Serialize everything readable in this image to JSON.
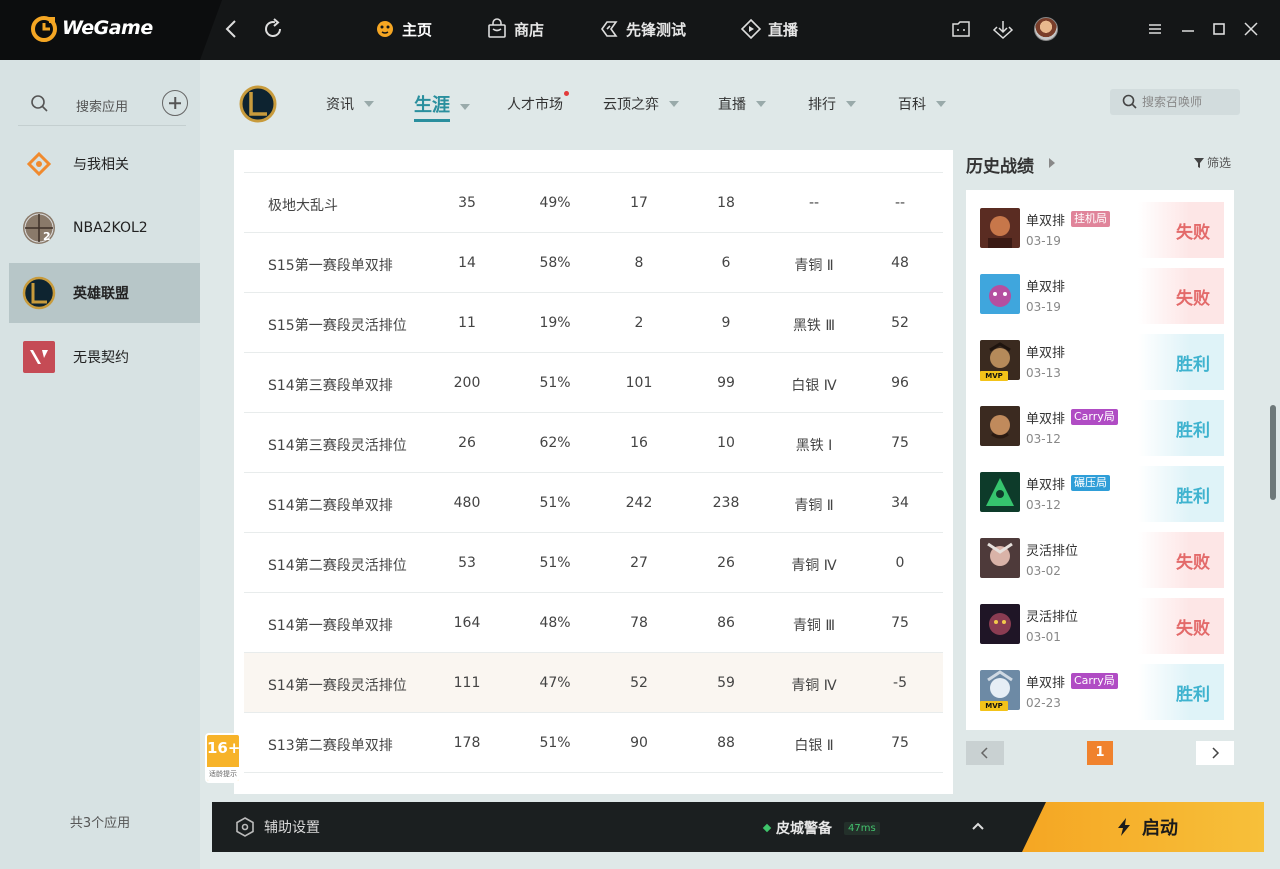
{
  "app": {
    "name": "WeGame"
  },
  "main_nav": [
    {
      "label": "主页",
      "icon": "home-cat-icon",
      "active": true
    },
    {
      "label": "商店",
      "icon": "store-bag-icon",
      "active": false
    },
    {
      "label": "先锋测试",
      "icon": "pioneer-test-icon",
      "active": false
    },
    {
      "label": "直播",
      "icon": "live-stream-icon",
      "active": false
    }
  ],
  "sidebar": {
    "search_label": "搜索应用",
    "items": [
      {
        "label": "与我相关",
        "icon": "related-to-me-icon",
        "active": false
      },
      {
        "label": "NBA2KOL2",
        "icon": "nba2kol2-icon",
        "active": false
      },
      {
        "label": "英雄联盟",
        "icon": "league-of-legends-icon",
        "active": true
      },
      {
        "label": "无畏契约",
        "icon": "valorant-icon",
        "active": false
      }
    ],
    "footer": "共3个应用"
  },
  "sub_nav": {
    "tabs": [
      {
        "label": "资讯",
        "has_caret": true,
        "active": false,
        "dot": false
      },
      {
        "label": "生涯",
        "has_caret": true,
        "active": true,
        "dot": false
      },
      {
        "label": "人才市场",
        "has_caret": false,
        "active": false,
        "dot": true
      },
      {
        "label": "云顶之弈",
        "has_caret": true,
        "active": false,
        "dot": false
      },
      {
        "label": "直播",
        "has_caret": true,
        "active": false,
        "dot": false
      },
      {
        "label": "排行",
        "has_caret": true,
        "active": false,
        "dot": false
      },
      {
        "label": "百科",
        "has_caret": true,
        "active": false,
        "dot": false
      }
    ],
    "search_placeholder": "搜索召唤师"
  },
  "career_table": {
    "rows": [
      [
        "极地大乱斗",
        "35",
        "49%",
        "17",
        "18",
        "--",
        "--"
      ],
      [
        "S15第一赛段单双排",
        "14",
        "58%",
        "8",
        "6",
        "青铜 Ⅱ",
        "48"
      ],
      [
        "S15第一赛段灵活排位",
        "11",
        "19%",
        "2",
        "9",
        "黑铁 Ⅲ",
        "52"
      ],
      [
        "S14第三赛段单双排",
        "200",
        "51%",
        "101",
        "99",
        "白银 Ⅳ",
        "96"
      ],
      [
        "S14第三赛段灵活排位",
        "26",
        "62%",
        "16",
        "10",
        "黑铁 Ⅰ",
        "75"
      ],
      [
        "S14第二赛段单双排",
        "480",
        "51%",
        "242",
        "238",
        "青铜 Ⅱ",
        "34"
      ],
      [
        "S14第二赛段灵活排位",
        "53",
        "51%",
        "27",
        "26",
        "青铜 Ⅳ",
        "0"
      ],
      [
        "S14第一赛段单双排",
        "164",
        "48%",
        "78",
        "86",
        "青铜 Ⅲ",
        "75"
      ],
      [
        "S14第一赛段灵活排位",
        "111",
        "47%",
        "52",
        "59",
        "青铜 Ⅳ",
        "-5"
      ],
      [
        "S13第二赛段单双排",
        "178",
        "51%",
        "90",
        "88",
        "白银 Ⅱ",
        "75"
      ]
    ],
    "highlighted_row": 8
  },
  "age_badge": {
    "rating": "16+",
    "note": "适龄提示"
  },
  "history": {
    "title": "历史战绩",
    "filter_label": "筛选",
    "matches": [
      {
        "mode": "单双排",
        "tag": "挂机局",
        "tag_color": "#e0849a",
        "date": "03-19",
        "result": "失败",
        "outcome": "loss",
        "mvp": false,
        "champ_colors": [
          "#5a2c22",
          "#c7774a"
        ]
      },
      {
        "mode": "单双排",
        "tag": "",
        "tag_color": "",
        "date": "03-19",
        "result": "失败",
        "outcome": "loss",
        "mvp": false,
        "champ_colors": [
          "#3fa6dd",
          "#b54fa0"
        ]
      },
      {
        "mode": "单双排",
        "tag": "",
        "tag_color": "",
        "date": "03-13",
        "result": "胜利",
        "outcome": "win",
        "mvp": true,
        "mvp_label": "MVP",
        "champ_colors": [
          "#3a2a1f",
          "#b58a5a"
        ]
      },
      {
        "mode": "单双排",
        "tag": "Carry局",
        "tag_color": "#b04cc4",
        "date": "03-12",
        "result": "胜利",
        "outcome": "win",
        "mvp": false,
        "champ_colors": [
          "#3b2a20",
          "#c08a5c"
        ]
      },
      {
        "mode": "单双排",
        "tag": "碾压局",
        "tag_color": "#2f9ed8",
        "date": "03-12",
        "result": "胜利",
        "outcome": "win",
        "mvp": false,
        "champ_colors": [
          "#0d3b2a",
          "#36c46e"
        ]
      },
      {
        "mode": "灵活排位",
        "tag": "",
        "tag_color": "",
        "date": "03-02",
        "result": "失败",
        "outcome": "loss",
        "mvp": false,
        "champ_colors": [
          "#4e3a3a",
          "#d9b3a8"
        ]
      },
      {
        "mode": "灵活排位",
        "tag": "",
        "tag_color": "",
        "date": "03-01",
        "result": "失败",
        "outcome": "loss",
        "mvp": false,
        "champ_colors": [
          "#1f1526",
          "#8a3c52"
        ]
      },
      {
        "mode": "单双排",
        "tag": "Carry局",
        "tag_color": "#b04cc4",
        "date": "02-23",
        "result": "胜利",
        "outcome": "win",
        "mvp": true,
        "mvp_label": "MVP",
        "champ_colors": [
          "#6d8aa5",
          "#e6eef5"
        ]
      }
    ],
    "current_page": "1"
  },
  "bottom_bar": {
    "assist_label": "辅助设置",
    "skin_status": "皮城警备",
    "ping": "47ms",
    "launch_label": "启动"
  },
  "colors": {
    "accent_teal": "#2a8f9e",
    "launch_orange": "#f5a623",
    "loss_red": "#e36a6a",
    "win_blue": "#3fb3cf"
  }
}
